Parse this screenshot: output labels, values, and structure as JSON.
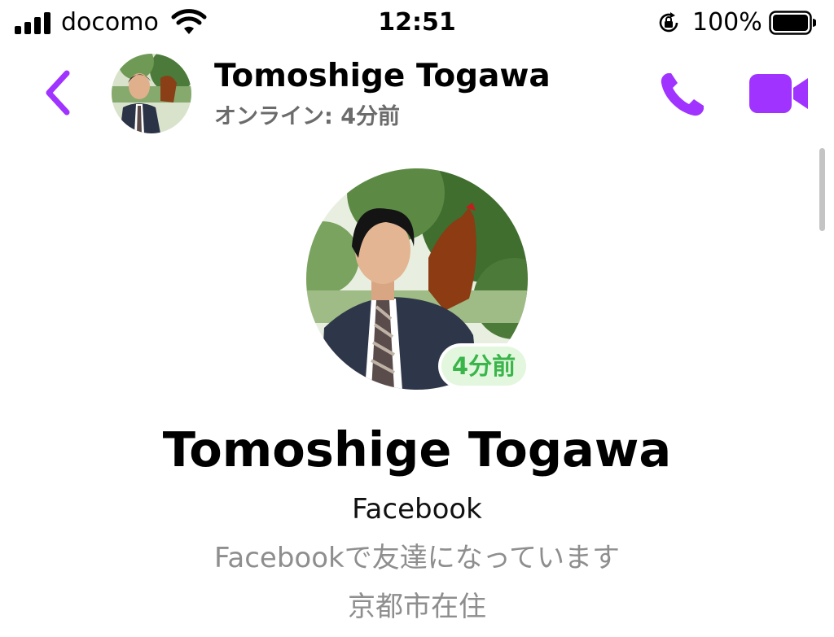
{
  "status_bar": {
    "carrier": "docomo",
    "time": "12:51",
    "battery_percent": "100%",
    "signal_icon": "cellular-signal-icon",
    "wifi_icon": "wifi-icon",
    "orientation_lock_icon": "orientation-lock-icon",
    "battery_icon": "battery-icon",
    "battery_level": 1.0
  },
  "header": {
    "name": "Tomoshige  Togawa",
    "status": "オンライン: 4分前",
    "back_icon": "chevron-left-icon",
    "call_icon": "phone-icon",
    "video_icon": "video-camera-icon",
    "accent_color": "#a033ff"
  },
  "profile": {
    "active_badge": "4分前",
    "name": "Tomoshige  Togawa",
    "source": "Facebook",
    "friends_text": "Facebookで友達になっています",
    "location": "京都市在住",
    "badge_color": "#39b54a"
  }
}
